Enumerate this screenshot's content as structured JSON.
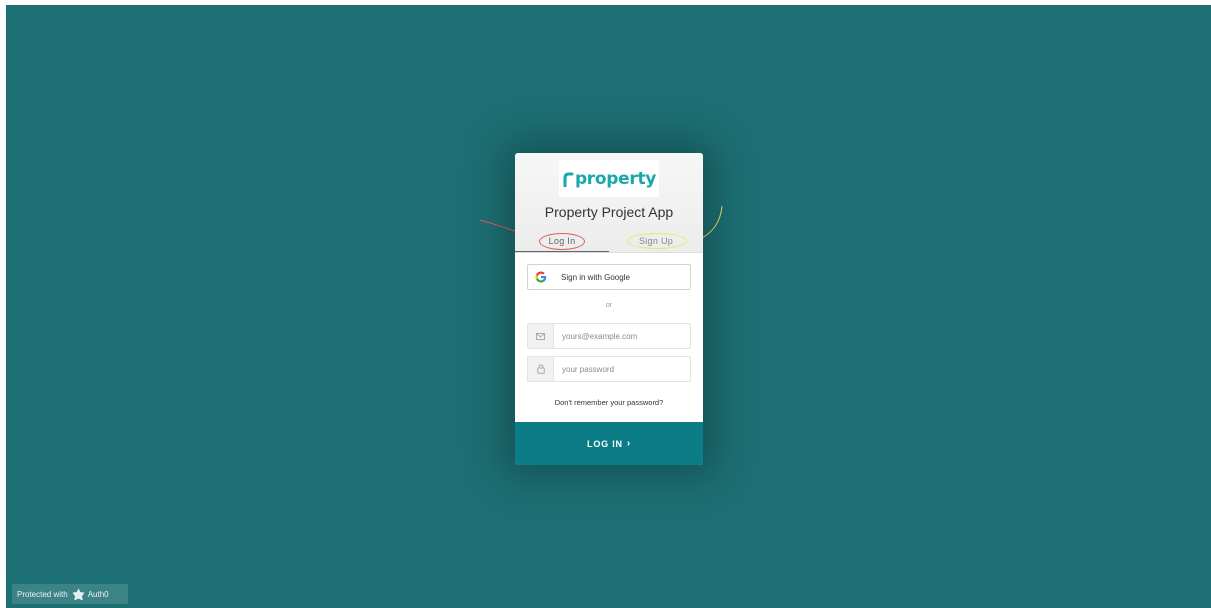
{
  "app": {
    "logo_text": "property",
    "title": "Property Project App"
  },
  "tabs": [
    {
      "label": "Log In",
      "active": true
    },
    {
      "label": "Sign Up",
      "active": false
    }
  ],
  "social": {
    "google_label": "Sign in with Google",
    "google_icon": "google-g-icon"
  },
  "divider": {
    "text": "or"
  },
  "fields": {
    "email": {
      "placeholder": "yours@example.com",
      "value": "",
      "icon": "envelope-icon"
    },
    "password": {
      "placeholder": "your password",
      "value": "",
      "icon": "lock-icon"
    }
  },
  "forgot_link": "Don't remember your password?",
  "submit": {
    "label": "LOG IN",
    "chevron": "›"
  },
  "footer": {
    "protected_text": "Protected with",
    "brand": "Auth0"
  },
  "colors": {
    "background": "#1c6f73",
    "submit": "#0c7d86",
    "logo": "#1aa7a8",
    "annotation_login": "#e35c5c",
    "annotation_signup": "#e8e85a"
  }
}
